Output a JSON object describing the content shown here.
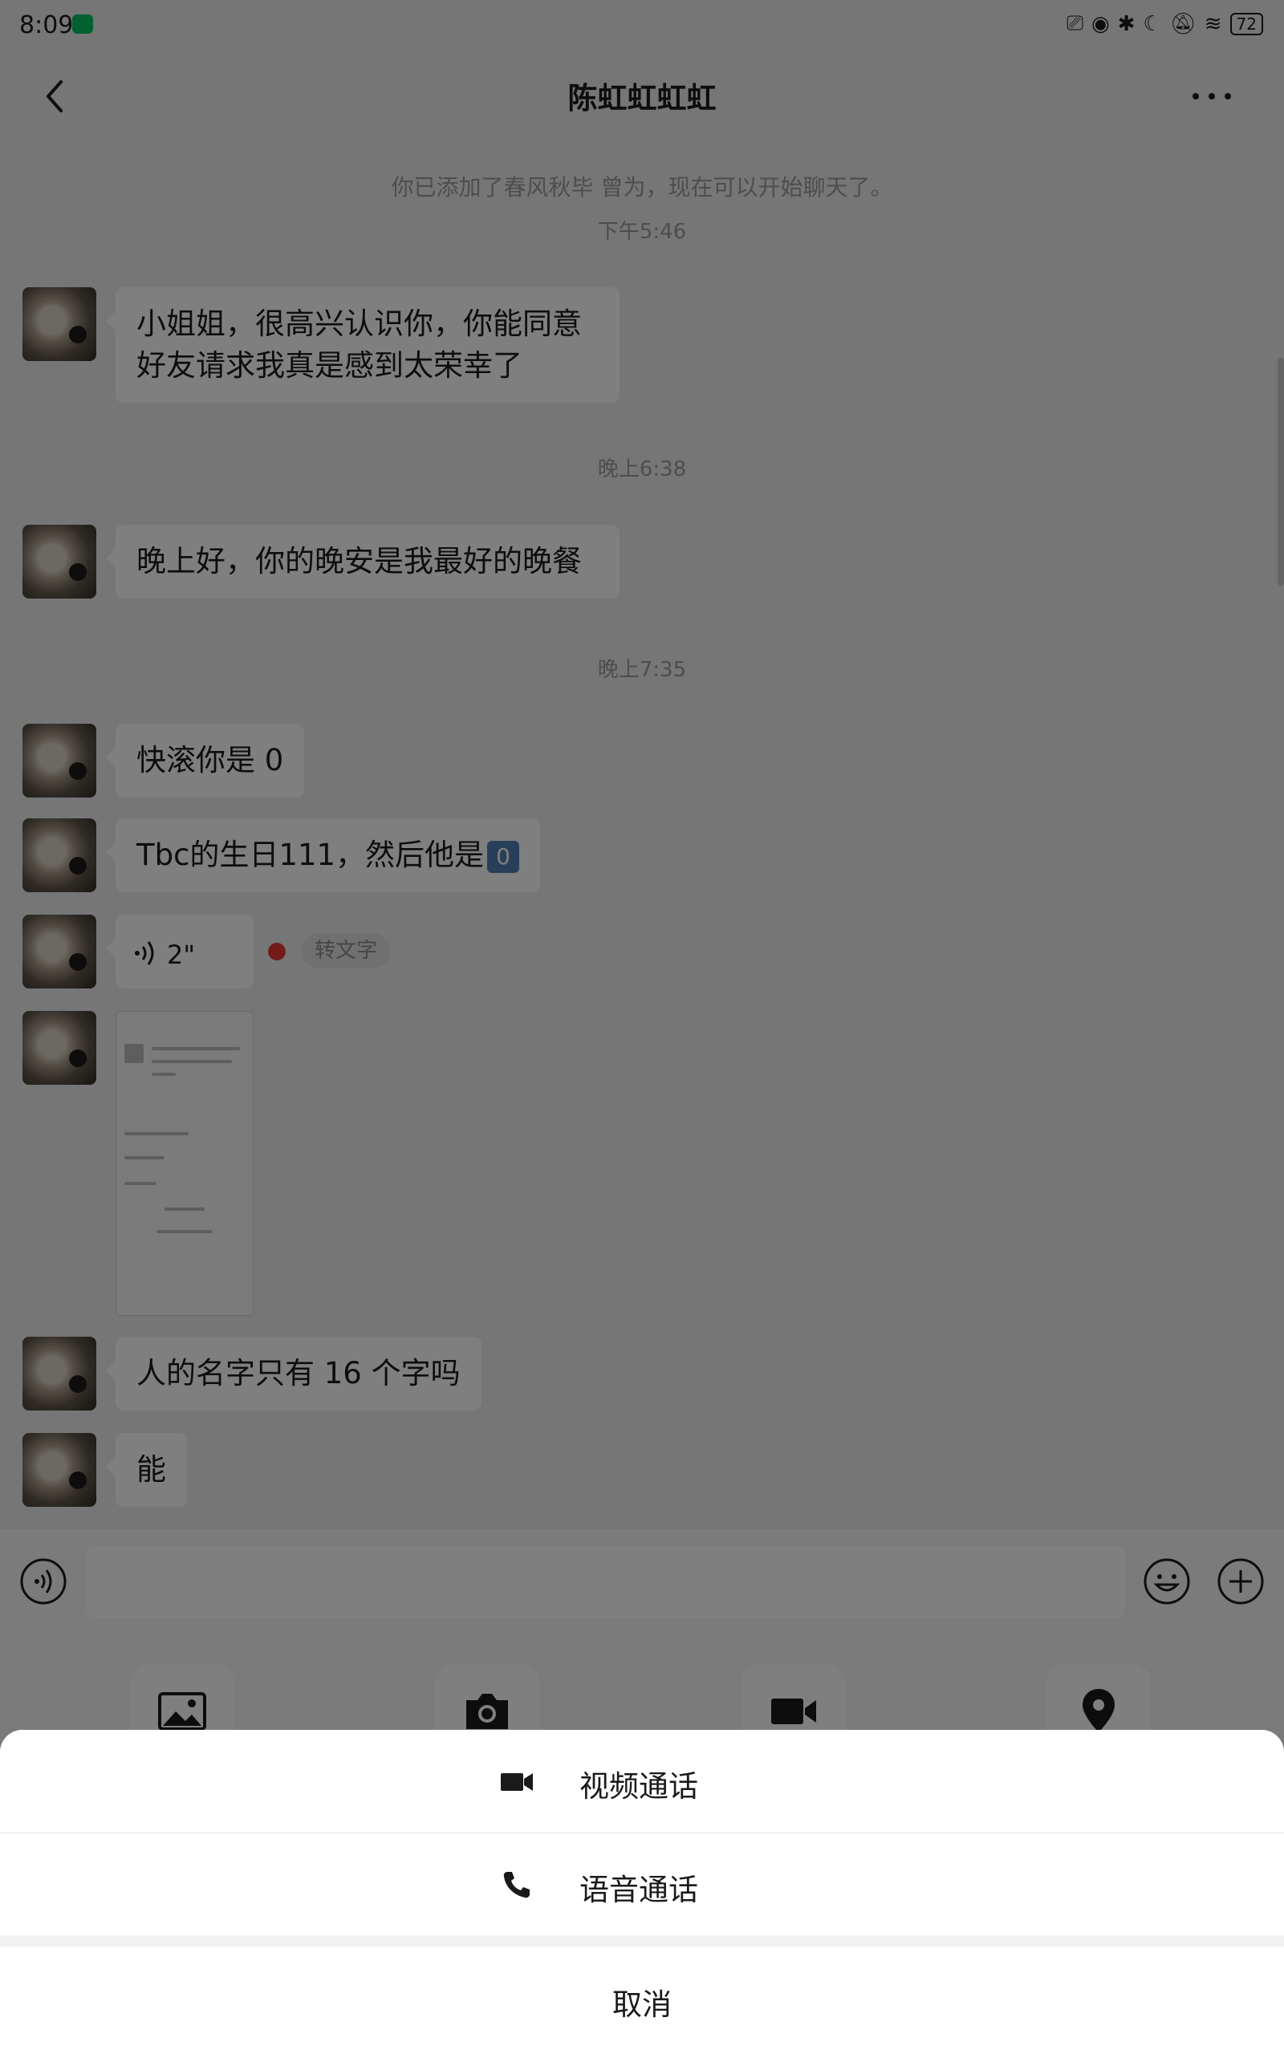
{
  "status_bar": {
    "time": "8:09",
    "battery": "72",
    "icons": [
      "cast-icon",
      "eye-icon",
      "bluetooth-icon",
      "moon-icon",
      "mute-icon",
      "wifi-icon"
    ]
  },
  "header": {
    "title": "陈虹虹虹虹",
    "system_notice": "你已添加了春风秋毕 曾为，现在可以开始聊天了。"
  },
  "messages": {
    "time_1": "下午5:46",
    "msg_1": "小姐姐，很高兴认识你，你能同意好友请求我真是感到太荣幸了",
    "time_2": "晚上6:38",
    "msg_2": "晚上好，你的晚安是我最好的晚餐",
    "time_3": "晚上7:35",
    "msg_3": "快滚你是 0",
    "msg_4": "Tbc的生日111，然后他是",
    "msg_4_badge": "0",
    "voice_duration": "2\"",
    "transcribe": "转文字",
    "msg_6": "人的名字只有 16 个字吗",
    "msg_7": "能"
  },
  "action_sheet": {
    "video_call": "视频通话",
    "voice_call": "语音通话",
    "cancel": "取消"
  },
  "colors": {
    "accent": "#07c160",
    "unread_dot": "#e53935",
    "badge_blue": "#4e7fb2"
  }
}
